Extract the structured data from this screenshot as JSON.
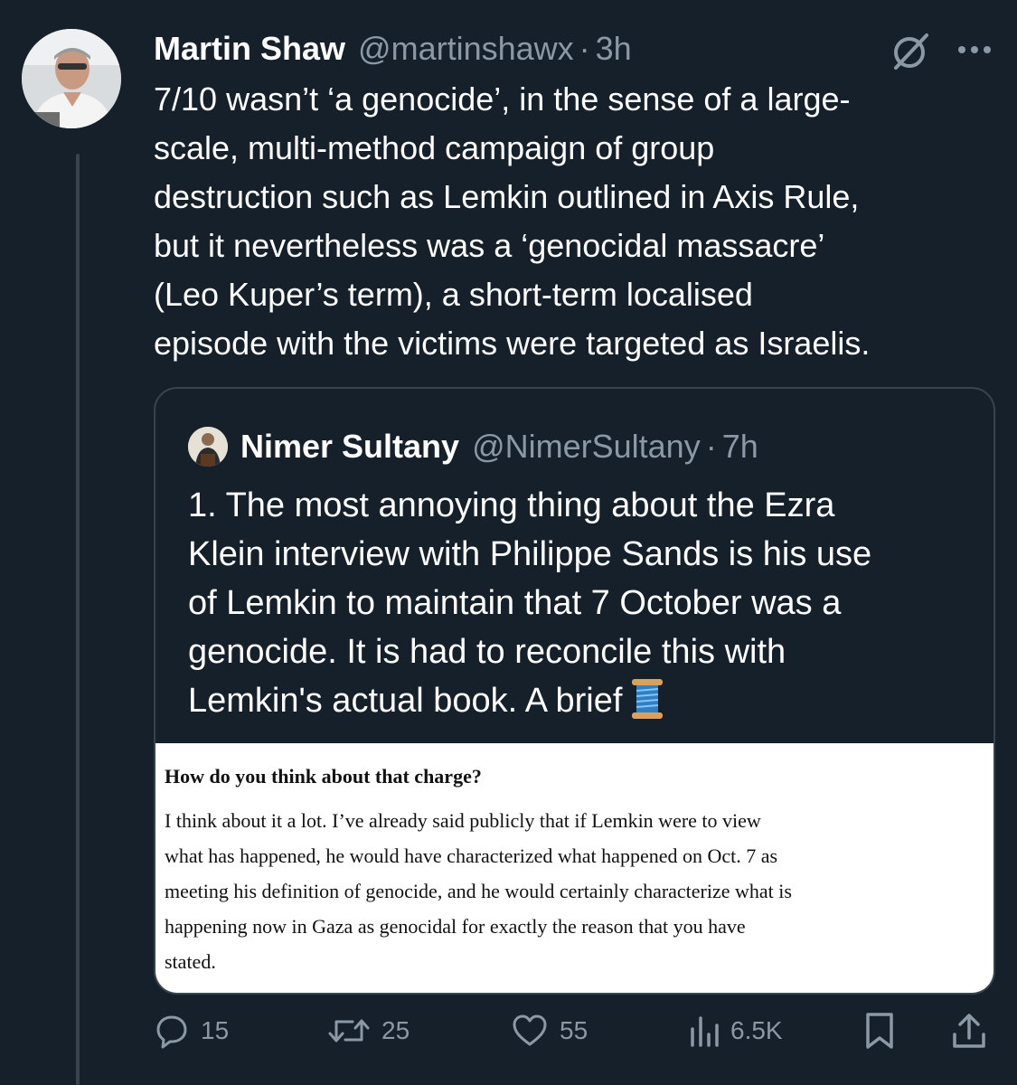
{
  "tweet": {
    "author_name": "Martin Shaw",
    "author_handle": "@martinshawx",
    "separator": "·",
    "time": "3h",
    "text": "7/10 wasn’t ‘a genocide’, in the sense of a large-\nscale, multi-method campaign of group\ndestruction such as Lemkin outlined in Axis Rule,\nbut it nevertheless was a ‘genocidal massacre’\n(Leo Kuper’s term), a short-term localised\nepisode with the victims were targeted as Israelis.",
    "avatar_icon": "user-avatar",
    "grok_icon": "grok-icon",
    "more_icon": "more-icon"
  },
  "quote": {
    "author_name": "Nimer Sultany",
    "author_handle": "@NimerSultany",
    "separator": "·",
    "time": "7h",
    "text": "1. The most annoying thing about the Ezra\nKlein interview with Philippe Sands is his use\nof Lemkin to maintain that 7 October was a\ngenocide. It is had to reconcile this with\nLemkin's actual book. A brief",
    "thread_emoji": "spool-of-thread",
    "image": {
      "heading": "How do you think about that charge?",
      "body": "I think about it a lot. I’ve already said publicly that if Lemkin were to view\nwhat has happened, he would have characterized what happened on Oct. 7 as\nmeeting his definition of genocide, and he would certainly characterize what is\nhappening now in Gaza as genocidal for exactly the reason that you have\nstated."
    }
  },
  "actions": {
    "replies": "15",
    "retweets": "25",
    "likes": "55",
    "views": "6.5K",
    "icons": [
      "reply-icon",
      "retweet-icon",
      "like-icon",
      "views-icon",
      "bookmark-icon",
      "share-icon"
    ]
  },
  "colors": {
    "background": "#15202b",
    "text_primary": "#ffffff",
    "text_secondary": "#8b98a5",
    "border": "#38444d"
  }
}
